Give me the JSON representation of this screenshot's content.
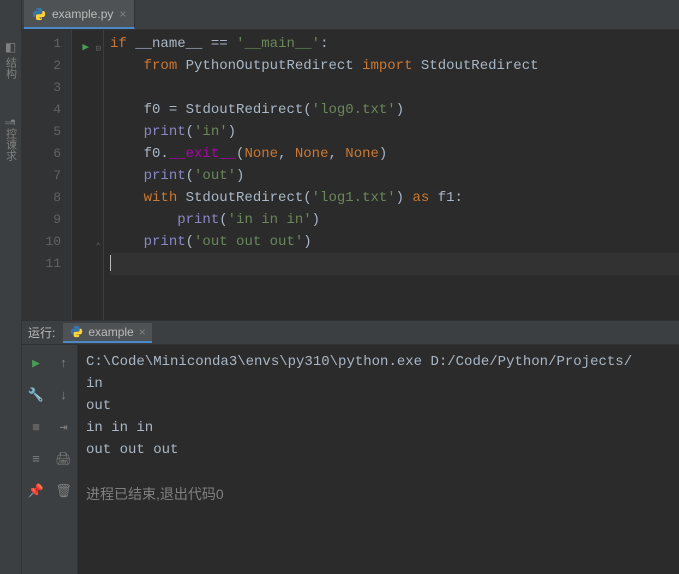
{
  "left_tools": [
    {
      "label": "结构",
      "icon": "◧"
    },
    {
      "label": "控谏求",
      "icon": "¶"
    }
  ],
  "tab": {
    "filename": "example.py"
  },
  "code_lines": [
    {
      "n": 1,
      "tokens": [
        [
          "kw",
          "if"
        ],
        [
          "op",
          " "
        ],
        [
          "id",
          "__name__"
        ],
        [
          "op",
          " "
        ],
        [
          "op",
          "=="
        ],
        [
          "op",
          " "
        ],
        [
          "str",
          "'__main__'"
        ],
        [
          "op",
          ":"
        ]
      ]
    },
    {
      "n": 2,
      "tokens": [
        [
          "op",
          "    "
        ],
        [
          "kw",
          "from"
        ],
        [
          "op",
          " "
        ],
        [
          "id",
          "PythonOutputRedirect"
        ],
        [
          "op",
          " "
        ],
        [
          "kw",
          "import"
        ],
        [
          "op",
          " "
        ],
        [
          "id",
          "StdoutRedirect"
        ]
      ]
    },
    {
      "n": 3,
      "tokens": []
    },
    {
      "n": 4,
      "tokens": [
        [
          "op",
          "    "
        ],
        [
          "id",
          "f0"
        ],
        [
          "op",
          " = "
        ],
        [
          "id",
          "StdoutRedirect"
        ],
        [
          "op",
          "("
        ],
        [
          "str",
          "'log0.txt'"
        ],
        [
          "op",
          ")"
        ]
      ]
    },
    {
      "n": 5,
      "tokens": [
        [
          "op",
          "    "
        ],
        [
          "builtin",
          "print"
        ],
        [
          "op",
          "("
        ],
        [
          "str",
          "'in'"
        ],
        [
          "op",
          ")"
        ]
      ]
    },
    {
      "n": 6,
      "tokens": [
        [
          "op",
          "    "
        ],
        [
          "id",
          "f0"
        ],
        [
          "op",
          "."
        ],
        [
          "mag",
          "__exit__"
        ],
        [
          "op",
          "("
        ],
        [
          "param",
          "None"
        ],
        [
          "op",
          ", "
        ],
        [
          "param",
          "None"
        ],
        [
          "op",
          ", "
        ],
        [
          "param",
          "None"
        ],
        [
          "op",
          ")"
        ]
      ]
    },
    {
      "n": 7,
      "tokens": [
        [
          "op",
          "    "
        ],
        [
          "builtin",
          "print"
        ],
        [
          "op",
          "("
        ],
        [
          "str",
          "'out'"
        ],
        [
          "op",
          ")"
        ]
      ]
    },
    {
      "n": 8,
      "tokens": [
        [
          "op",
          "    "
        ],
        [
          "kw",
          "with"
        ],
        [
          "op",
          " "
        ],
        [
          "id",
          "StdoutRedirect"
        ],
        [
          "op",
          "("
        ],
        [
          "str",
          "'log1.txt'"
        ],
        [
          "op",
          ") "
        ],
        [
          "kw",
          "as"
        ],
        [
          "op",
          " "
        ],
        [
          "id",
          "f1"
        ],
        [
          "op",
          ":"
        ]
      ]
    },
    {
      "n": 9,
      "tokens": [
        [
          "op",
          "        "
        ],
        [
          "builtin",
          "print"
        ],
        [
          "op",
          "("
        ],
        [
          "str",
          "'in in in'"
        ],
        [
          "op",
          ")"
        ]
      ]
    },
    {
      "n": 10,
      "tokens": [
        [
          "op",
          "    "
        ],
        [
          "builtin",
          "print"
        ],
        [
          "op",
          "("
        ],
        [
          "str",
          "'out out out'"
        ],
        [
          "op",
          ")"
        ]
      ]
    },
    {
      "n": 11,
      "tokens": []
    }
  ],
  "run": {
    "title": "运行:",
    "tab_name": "example",
    "output": [
      "C:\\Code\\Miniconda3\\envs\\py310\\python.exe D:/Code/Python/Projects/",
      "in",
      "out",
      "in in in",
      "out out out",
      "",
      "进程已结束,退出代码0"
    ]
  }
}
